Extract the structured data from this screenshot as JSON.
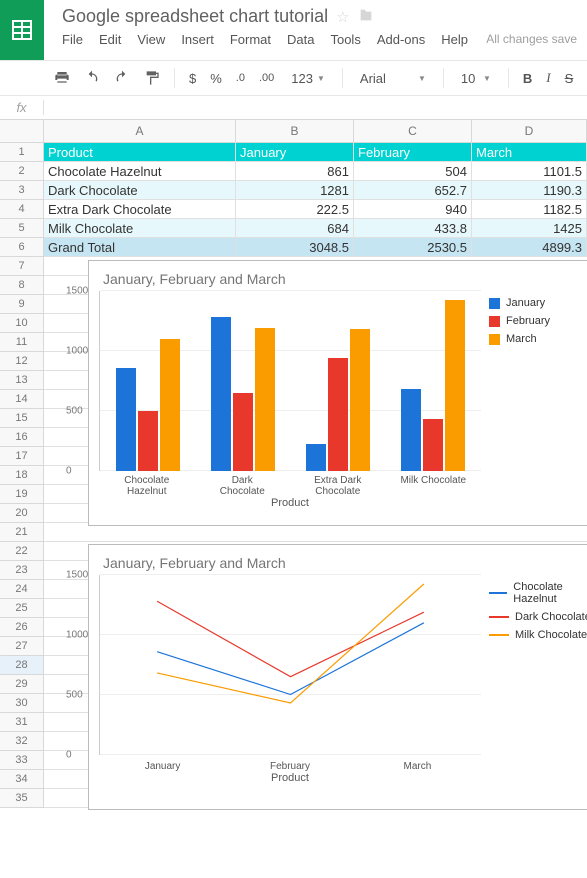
{
  "doc": {
    "title": "Google spreadsheet chart tutorial",
    "saved": "All changes save"
  },
  "menu": {
    "file": "File",
    "edit": "Edit",
    "view": "View",
    "insert": "Insert",
    "format": "Format",
    "data": "Data",
    "tools": "Tools",
    "addons": "Add-ons",
    "help": "Help"
  },
  "toolbar": {
    "dollar": "$",
    "percent": "%",
    "dec_dec": ".0",
    "inc_dec": ".00",
    "n123": "123",
    "font": "Arial",
    "size": "10"
  },
  "fx": {
    "label": "fx"
  },
  "columns": {
    "A": "A",
    "B": "B",
    "C": "C",
    "D": "D"
  },
  "selected_row": 28,
  "table": {
    "header": {
      "product": "Product",
      "jan": "January",
      "feb": "February",
      "mar": "March"
    },
    "rows": [
      {
        "product": "Chocolate Hazelnut",
        "jan": "861",
        "feb": "504",
        "mar": "1101.5"
      },
      {
        "product": "Dark Chocolate",
        "jan": "1281",
        "feb": "652.7",
        "mar": "1190.3"
      },
      {
        "product": "Extra Dark Chocolate",
        "jan": "222.5",
        "feb": "940",
        "mar": "1182.5"
      },
      {
        "product": "Milk Chocolate",
        "jan": "684",
        "feb": "433.8",
        "mar": "1425"
      }
    ],
    "total": {
      "label": "Grand Total",
      "jan": "3048.5",
      "feb": "2530.5",
      "mar": "4899.3"
    }
  },
  "chart_data": [
    {
      "type": "bar",
      "title": "January, February and March",
      "xlabel": "Product",
      "ylabel": "",
      "ylim": [
        0,
        1500
      ],
      "yticks": [
        0,
        500,
        1000,
        1500
      ],
      "categories": [
        "Chocolate Hazelnut",
        "Dark Chocolate",
        "Extra Dark Chocolate",
        "Milk Chocolate"
      ],
      "series": [
        {
          "name": "January",
          "color": "#1c74d8",
          "values": [
            861,
            1281,
            222.5,
            684
          ]
        },
        {
          "name": "February",
          "color": "#e8382b",
          "values": [
            504,
            652.7,
            940,
            433.8
          ]
        },
        {
          "name": "March",
          "color": "#fa9c00",
          "values": [
            1101.5,
            1190.3,
            1182.5,
            1425
          ]
        }
      ]
    },
    {
      "type": "line",
      "title": "January, February and March",
      "xlabel": "Product",
      "ylabel": "",
      "ylim": [
        0,
        1500
      ],
      "yticks": [
        0,
        500,
        1000,
        1500
      ],
      "categories": [
        "January",
        "February",
        "March"
      ],
      "series": [
        {
          "name": "Chocolate Hazelnut",
          "color": "#1c74d8",
          "values": [
            861,
            504,
            1101.5
          ]
        },
        {
          "name": "Dark Chocolate",
          "color": "#e8382b",
          "values": [
            1281,
            652.7,
            1190.3
          ]
        },
        {
          "name": "Milk Chocolate",
          "color": "#fa9c00",
          "values": [
            684,
            433.8,
            1425
          ]
        }
      ]
    }
  ],
  "cat_short": {
    "0": "Chocolate\nHazelnut",
    "1": "Dark Chocolate",
    "2": "Extra Dark\nChocolate",
    "3": "Milk Chocolate"
  }
}
